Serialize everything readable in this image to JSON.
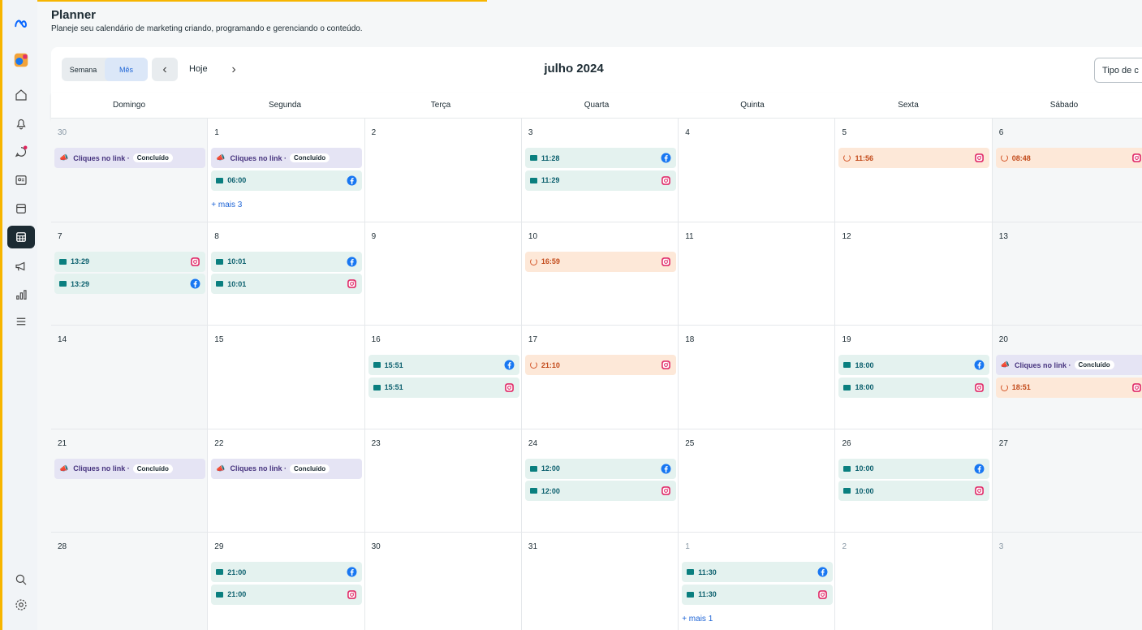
{
  "app": {
    "title": "Planner",
    "subtitle": "Planeje seu calendário de marketing criando, programando e gerenciando o conteúdo."
  },
  "toolbar": {
    "week_label": "Semana",
    "month_label": "Mês",
    "today_label": "Hoje",
    "month_title": "julho 2024",
    "filter_label": "Tipo de c"
  },
  "weekdays": [
    "Domingo",
    "Segunda",
    "Terça",
    "Quarta",
    "Quinta",
    "Sexta",
    "Sábado"
  ],
  "sidebar": {
    "icons": [
      "meta-logo-icon",
      "account-avatar-icon",
      "home-icon",
      "notifications-icon",
      "inbox-icon",
      "contacts-icon",
      "content-icon",
      "planner-icon",
      "ads-icon",
      "insights-icon",
      "menu-icon",
      "search-icon",
      "settings-icon"
    ],
    "active": "planner-icon"
  },
  "colors": {
    "accent": "#1d64d6",
    "post_bg": "#e4f2ef",
    "pending_bg": "#fde8d8",
    "ad_bg": "#e5e4f4",
    "facebook": "#1877f2",
    "instagram": "#e1306c",
    "brand_stripe": "#f7b500"
  },
  "ad_label": "Cliques no link ·",
  "ad_status": "Concluído",
  "weeks": [
    [
      {
        "d": "30",
        "other": true,
        "events": [
          {
            "type": "ad"
          }
        ]
      },
      {
        "d": "1",
        "events": [
          {
            "type": "ad"
          },
          {
            "type": "post",
            "time": "06:00",
            "net": "fb"
          }
        ],
        "more": "+ mais 3"
      },
      {
        "d": "2",
        "events": []
      },
      {
        "d": "3",
        "events": [
          {
            "type": "post",
            "time": "11:28",
            "net": "fb"
          },
          {
            "type": "post",
            "time": "11:29",
            "net": "ig"
          }
        ]
      },
      {
        "d": "4",
        "events": []
      },
      {
        "d": "5",
        "events": [
          {
            "type": "pend",
            "time": "11:56",
            "net": "ig"
          }
        ]
      },
      {
        "d": "6",
        "events": [
          {
            "type": "pend",
            "time": "08:48",
            "net": "ig"
          }
        ]
      }
    ],
    [
      {
        "d": "7",
        "events": [
          {
            "type": "post",
            "time": "13:29",
            "net": "ig"
          },
          {
            "type": "post",
            "time": "13:29",
            "net": "fb"
          }
        ]
      },
      {
        "d": "8",
        "events": [
          {
            "type": "post",
            "time": "10:01",
            "net": "fb"
          },
          {
            "type": "post",
            "time": "10:01",
            "net": "ig"
          }
        ]
      },
      {
        "d": "9",
        "events": []
      },
      {
        "d": "10",
        "events": [
          {
            "type": "pend",
            "time": "16:59",
            "net": "ig"
          }
        ]
      },
      {
        "d": "11",
        "events": []
      },
      {
        "d": "12",
        "events": []
      },
      {
        "d": "13",
        "events": []
      }
    ],
    [
      {
        "d": "14",
        "events": []
      },
      {
        "d": "15",
        "events": []
      },
      {
        "d": "16",
        "events": [
          {
            "type": "post",
            "time": "15:51",
            "net": "fb"
          },
          {
            "type": "post",
            "time": "15:51",
            "net": "ig"
          }
        ]
      },
      {
        "d": "17",
        "events": [
          {
            "type": "pend",
            "time": "21:10",
            "net": "ig"
          }
        ]
      },
      {
        "d": "18",
        "events": []
      },
      {
        "d": "19",
        "events": [
          {
            "type": "post",
            "time": "18:00",
            "net": "fb"
          },
          {
            "type": "post",
            "time": "18:00",
            "net": "ig"
          }
        ]
      },
      {
        "d": "20",
        "events": [
          {
            "type": "ad"
          },
          {
            "type": "pend",
            "time": "18:51",
            "net": "ig"
          }
        ]
      }
    ],
    [
      {
        "d": "21",
        "events": [
          {
            "type": "ad"
          }
        ]
      },
      {
        "d": "22",
        "events": [
          {
            "type": "ad"
          }
        ]
      },
      {
        "d": "23",
        "events": []
      },
      {
        "d": "24",
        "events": [
          {
            "type": "post",
            "time": "12:00",
            "net": "fb"
          },
          {
            "type": "post",
            "time": "12:00",
            "net": "ig"
          }
        ]
      },
      {
        "d": "25",
        "events": []
      },
      {
        "d": "26",
        "events": [
          {
            "type": "post",
            "time": "10:00",
            "net": "fb"
          },
          {
            "type": "post",
            "time": "10:00",
            "net": "ig"
          }
        ]
      },
      {
        "d": "27",
        "events": []
      }
    ],
    [
      {
        "d": "28",
        "events": []
      },
      {
        "d": "29",
        "events": [
          {
            "type": "post",
            "time": "21:00",
            "net": "fb"
          },
          {
            "type": "post",
            "time": "21:00",
            "net": "ig"
          }
        ]
      },
      {
        "d": "30",
        "events": []
      },
      {
        "d": "31",
        "events": []
      },
      {
        "d": "1",
        "other": true,
        "events": [
          {
            "type": "post",
            "time": "11:30",
            "net": "fb"
          },
          {
            "type": "post",
            "time": "11:30",
            "net": "ig"
          }
        ],
        "more": "+ mais 1"
      },
      {
        "d": "2",
        "other": true,
        "events": []
      },
      {
        "d": "3",
        "other": true,
        "events": []
      }
    ]
  ]
}
